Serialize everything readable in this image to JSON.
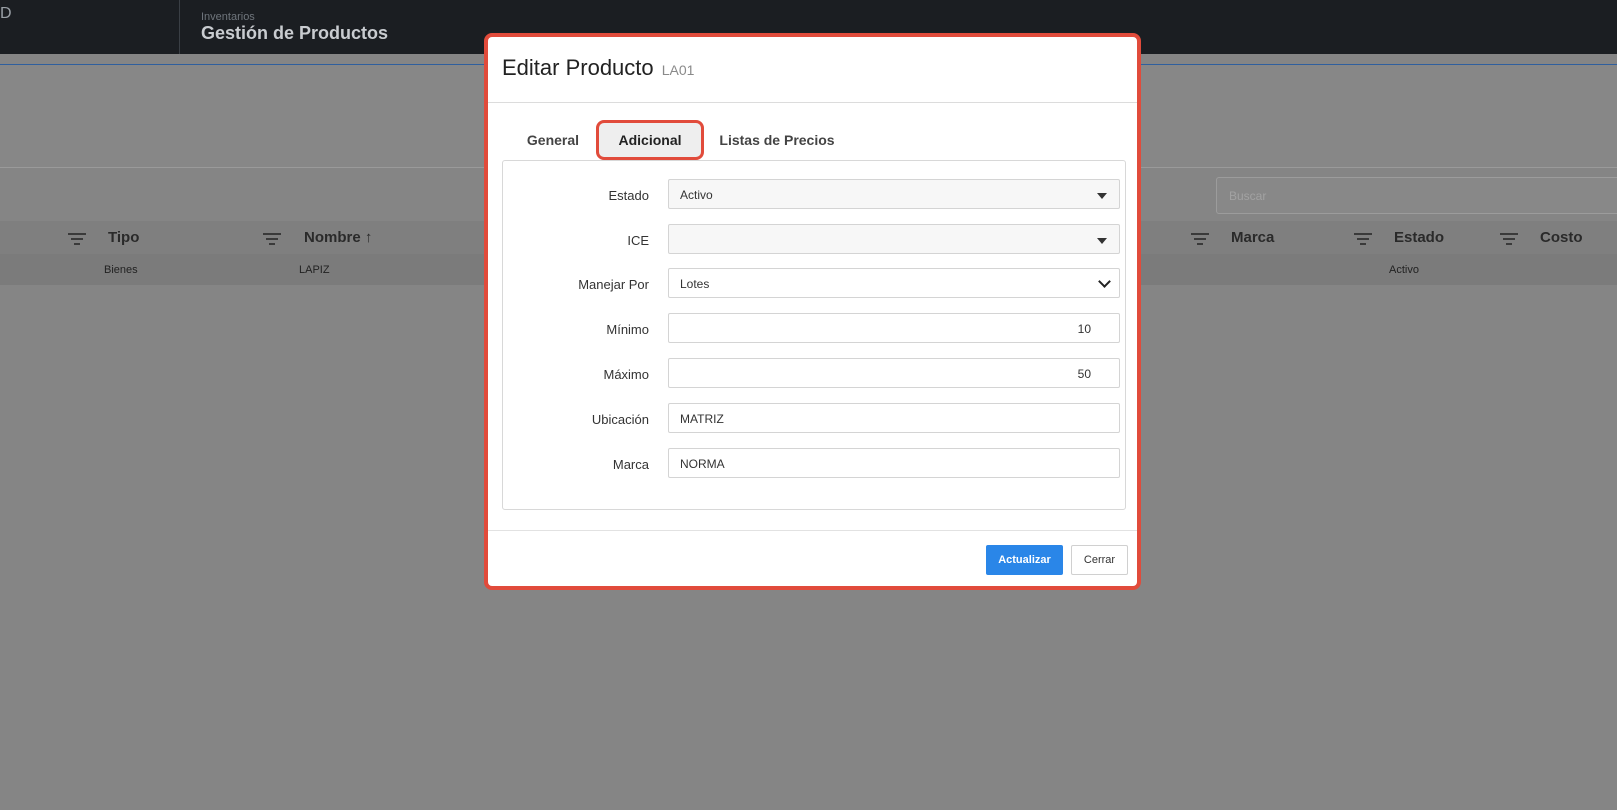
{
  "header": {
    "brand_fragment": "D",
    "breadcrumb": "Inventarios",
    "title": "Gestión de Productos"
  },
  "search": {
    "placeholder": "Buscar"
  },
  "table": {
    "columns": [
      "Tipo",
      "Nombre ↑",
      "Marca",
      "Estado",
      "Costo"
    ],
    "rows": [
      {
        "tipo": "Bienes",
        "nombre": "LAPIZ",
        "marca": "",
        "estado": "Activo",
        "costo": ""
      }
    ]
  },
  "modal": {
    "title": "Editar Producto",
    "code": "LA01",
    "tabs": [
      "General",
      "Adicional",
      "Listas de Precios"
    ],
    "active_tab": "Adicional",
    "fields": {
      "estado": {
        "label": "Estado",
        "value": "Activo"
      },
      "ice": {
        "label": "ICE",
        "value": ""
      },
      "manejar_por": {
        "label": "Manejar Por",
        "value": "Lotes"
      },
      "minimo": {
        "label": "Mínimo",
        "value": "10"
      },
      "maximo": {
        "label": "Máximo",
        "value": "50"
      },
      "ubicacion": {
        "label": "Ubicación",
        "value": "MATRIZ"
      },
      "marca": {
        "label": "Marca",
        "value": "NORMA"
      }
    },
    "buttons": {
      "update": "Actualizar",
      "close": "Cerrar"
    }
  },
  "colors": {
    "highlight": "#e14b3b",
    "primary": "#2a86e8",
    "topbar": "#1b1e22"
  },
  "icons": [
    "filter-icon",
    "dropdown-caret-icon",
    "chevron-down-icon",
    "annotation-arrow-icon"
  ]
}
